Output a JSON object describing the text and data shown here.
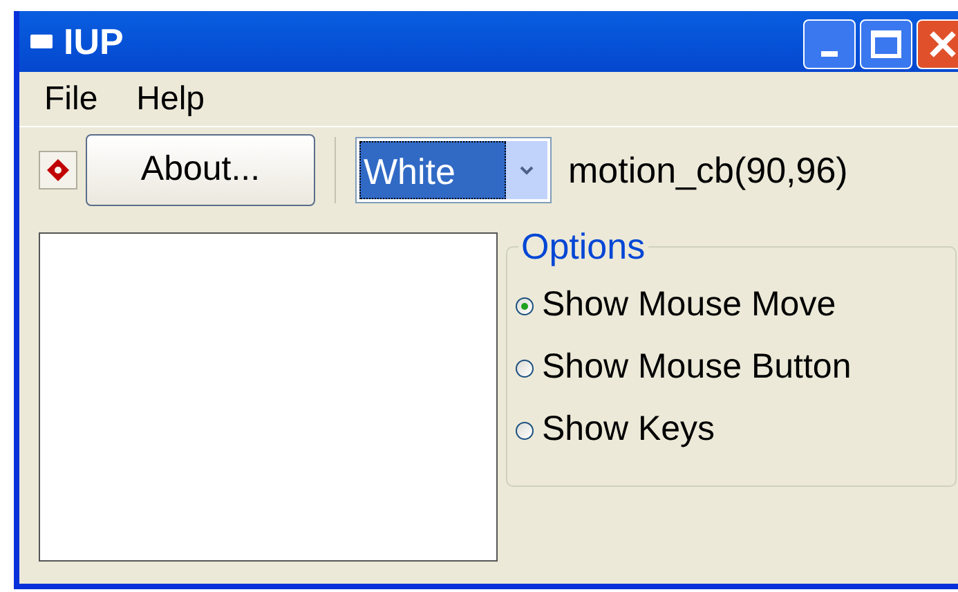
{
  "window": {
    "title": "IUP"
  },
  "menu": [
    {
      "label": "File"
    },
    {
      "label": "Help"
    }
  ],
  "toolbar": {
    "about_button": "About...",
    "dropdown": {
      "value": "White"
    },
    "status": "motion_cb(90,96)"
  },
  "options": {
    "title": "Options",
    "items": [
      {
        "label": "Show Mouse Move",
        "selected": true
      },
      {
        "label": "Show Mouse Button",
        "selected": false
      },
      {
        "label": "Show Keys",
        "selected": false
      }
    ]
  }
}
